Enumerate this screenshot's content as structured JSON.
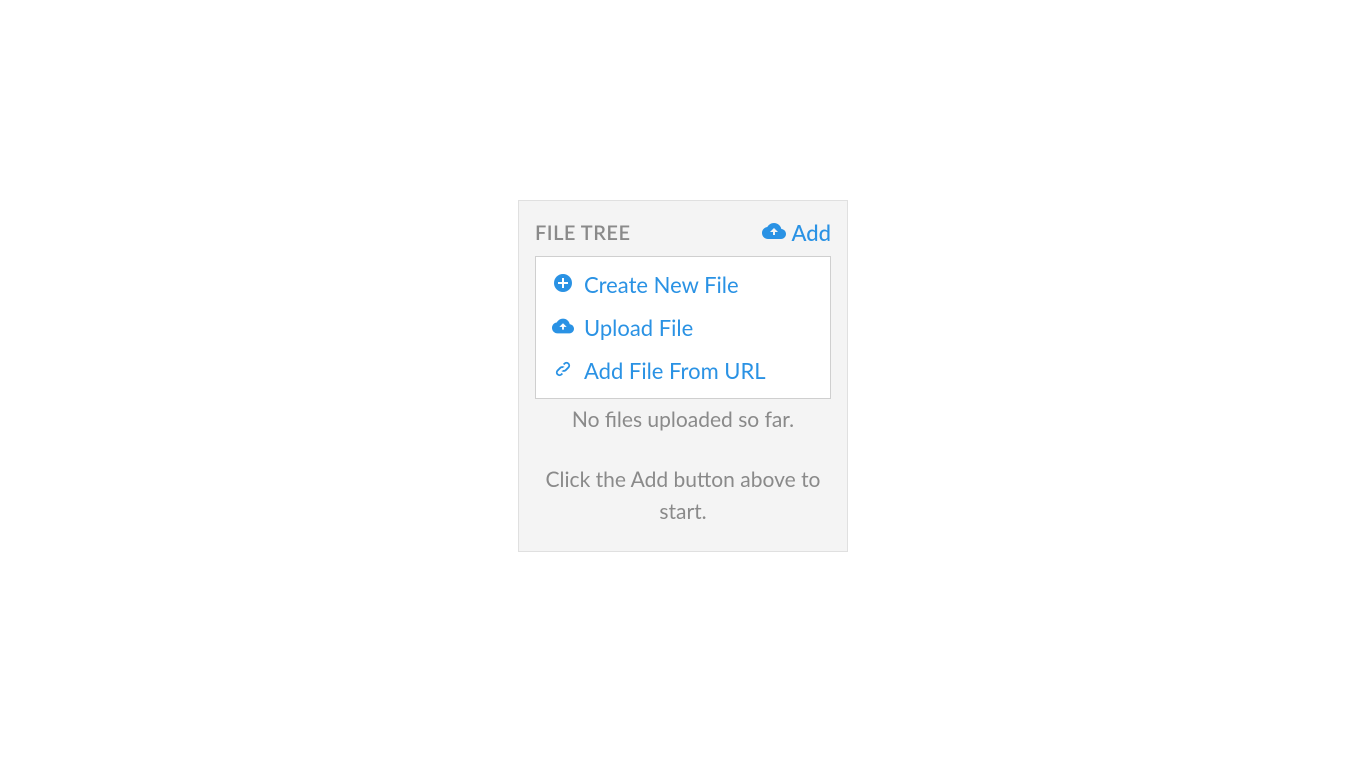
{
  "panel": {
    "title": "FILE TREE",
    "add_label": "Add",
    "menu": {
      "create": "Create New File",
      "upload": "Upload File",
      "url": "Add File From URL"
    },
    "empty": "No files uploaded so far.",
    "hint": "Click the Add button above to start."
  }
}
